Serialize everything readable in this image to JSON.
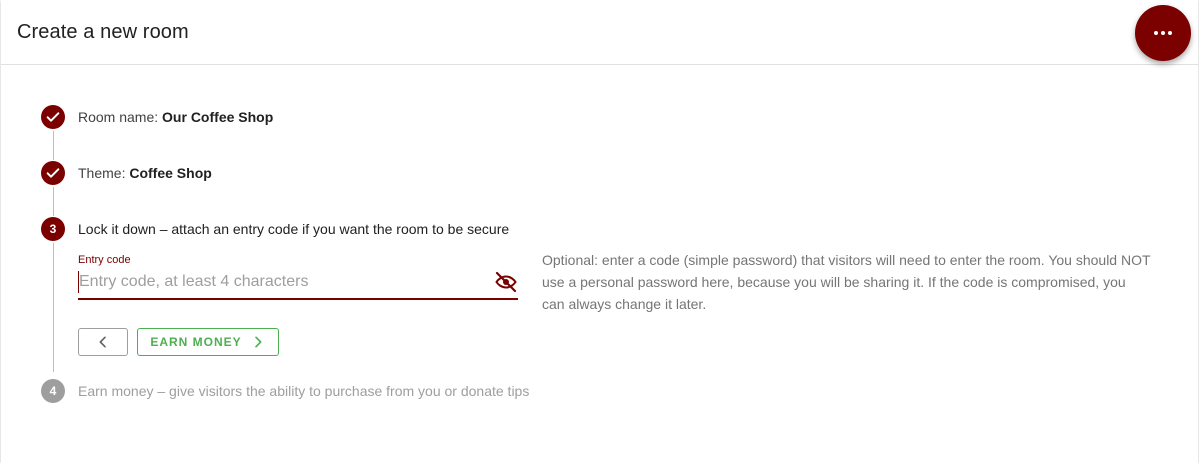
{
  "dialog": {
    "title": "Create a new room",
    "menu_icon": "more-horiz-icon",
    "accent_color": "#7b0000"
  },
  "steps": [
    {
      "number": "1",
      "state": "completed",
      "icon": "check-icon",
      "prefix": "Room name: ",
      "value": "Our Coffee Shop"
    },
    {
      "number": "2",
      "state": "completed",
      "icon": "check-icon",
      "prefix": "Theme: ",
      "value": "Coffee Shop"
    },
    {
      "number": "3",
      "state": "active",
      "label": "Lock it down – attach an entry code if you want the room to be secure"
    },
    {
      "number": "4",
      "state": "pending",
      "label": "Earn money – give visitors the ability to purchase from you or donate tips"
    }
  ],
  "entry_code": {
    "label": "Entry code",
    "placeholder": "Entry code, at least 4 characters",
    "value": "",
    "toggle_icon": "visibility-off-icon",
    "helper_text": "Optional: enter a code (simple password) that visitors will need to enter the room. You should NOT use a personal password here, because you will be sharing it. If the code is compromised, you can always change it later."
  },
  "actions": {
    "back_icon": "chevron-left-icon",
    "next_label": "EARN MONEY",
    "next_icon": "chevron-right-icon",
    "next_color": "#4caf50"
  }
}
